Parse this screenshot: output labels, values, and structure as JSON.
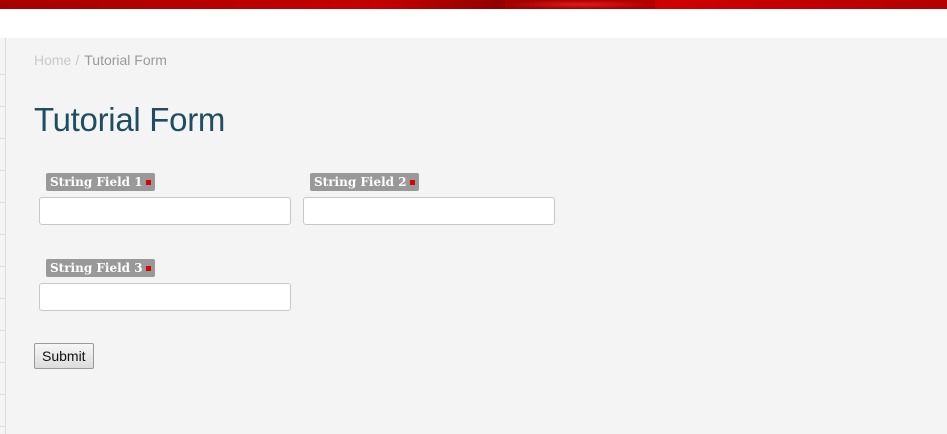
{
  "breadcrumb": {
    "home": "Home",
    "separator": "/",
    "current": "Tutorial Form"
  },
  "page": {
    "title": "Tutorial Form"
  },
  "form": {
    "fields": [
      {
        "label": "String Field 1",
        "value": "",
        "required": true
      },
      {
        "label": "String Field 2",
        "value": "",
        "required": true
      },
      {
        "label": "String Field 3",
        "value": "",
        "required": true
      }
    ],
    "submit_label": "Submit"
  },
  "colors": {
    "header_red": "#c40000",
    "title": "#1f4e61",
    "label_bg": "#999999",
    "required_marker": "#dd0000",
    "background": "#f4f4f4"
  }
}
